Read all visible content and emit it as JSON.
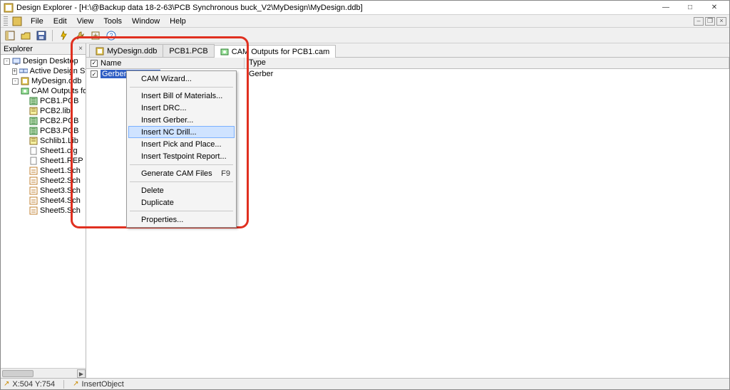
{
  "title": "Design Explorer - [H:\\@Backup data 18-2-63\\PCB Synchronous buck_V2\\MyDesign\\MyDesign.ddb]",
  "menus": {
    "file": "File",
    "edit": "Edit",
    "view": "View",
    "tools": "Tools",
    "window": "Window",
    "help": "Help"
  },
  "explorer": {
    "title": "Explorer",
    "items": [
      {
        "lvl": 0,
        "exp": "-",
        "icon": "desktop",
        "label": "Design Desktop"
      },
      {
        "lvl": 1,
        "exp": "+",
        "icon": "stations",
        "label": "Active Design Stations"
      },
      {
        "lvl": 1,
        "exp": "-",
        "icon": "ddb",
        "label": "MyDesign.ddb"
      },
      {
        "lvl": 2,
        "exp": "",
        "icon": "cam",
        "label": "CAM Outputs for PC"
      },
      {
        "lvl": 2,
        "exp": "",
        "icon": "pcb",
        "label": "PCB1.PCB"
      },
      {
        "lvl": 2,
        "exp": "",
        "icon": "lib",
        "label": "PCB2.lib"
      },
      {
        "lvl": 2,
        "exp": "",
        "icon": "pcb",
        "label": "PCB2.PCB"
      },
      {
        "lvl": 2,
        "exp": "",
        "icon": "pcb",
        "label": "PCB3.PCB"
      },
      {
        "lvl": 2,
        "exp": "",
        "icon": "lib",
        "label": "Schlib1.Lib"
      },
      {
        "lvl": 2,
        "exp": "",
        "icon": "file",
        "label": "Sheet1.cfg"
      },
      {
        "lvl": 2,
        "exp": "",
        "icon": "file",
        "label": "Sheet1.REP"
      },
      {
        "lvl": 2,
        "exp": "",
        "icon": "sch",
        "label": "Sheet1.Sch"
      },
      {
        "lvl": 2,
        "exp": "",
        "icon": "sch",
        "label": "Sheet2.Sch"
      },
      {
        "lvl": 2,
        "exp": "",
        "icon": "sch",
        "label": "Sheet3.Sch"
      },
      {
        "lvl": 2,
        "exp": "",
        "icon": "sch",
        "label": "Sheet4.Sch"
      },
      {
        "lvl": 2,
        "exp": "",
        "icon": "sch",
        "label": "Sheet5.Sch"
      }
    ]
  },
  "tabs": [
    {
      "label": "MyDesign.ddb",
      "active": false,
      "icon": "ddb"
    },
    {
      "label": "PCB1.PCB",
      "active": false,
      "icon": ""
    },
    {
      "label": "CAM Outputs for PCB1.cam",
      "active": true,
      "icon": "cam"
    }
  ],
  "list": {
    "cols": {
      "name": "Name",
      "type": "Type"
    },
    "rows": [
      {
        "checked": true,
        "name": "Gerber Output 1",
        "type": "Gerber",
        "selected": true
      }
    ]
  },
  "ctx": [
    {
      "t": "item",
      "label": "CAM Wizard..."
    },
    {
      "t": "sep"
    },
    {
      "t": "item",
      "label": "Insert Bill of Materials..."
    },
    {
      "t": "item",
      "label": "Insert DRC..."
    },
    {
      "t": "item",
      "label": "Insert Gerber..."
    },
    {
      "t": "item",
      "label": "Insert NC Drill...",
      "hover": true
    },
    {
      "t": "item",
      "label": "Insert Pick and Place..."
    },
    {
      "t": "item",
      "label": "Insert Testpoint Report..."
    },
    {
      "t": "sep"
    },
    {
      "t": "item",
      "label": "Generate CAM Files",
      "shortcut": "F9"
    },
    {
      "t": "sep"
    },
    {
      "t": "item",
      "label": "Delete"
    },
    {
      "t": "item",
      "label": "Duplicate"
    },
    {
      "t": "sep"
    },
    {
      "t": "item",
      "label": "Properties..."
    }
  ],
  "status": {
    "coords": "X:504 Y:754",
    "mode": "InsertObject"
  },
  "winbtns": {
    "min": "—",
    "max": "□",
    "close": "✕"
  },
  "docbtns": {
    "min": "–",
    "max": "❐",
    "close": "×"
  }
}
